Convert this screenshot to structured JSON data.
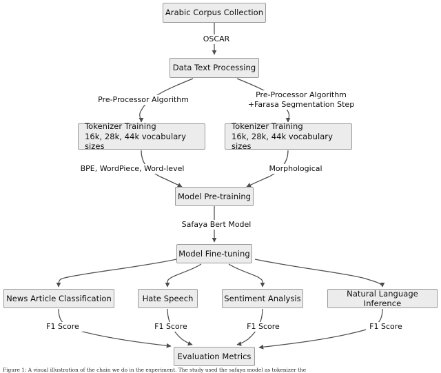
{
  "diagram": {
    "type": "flowchart",
    "title": "Arabic BERT pipeline flowchart",
    "colors": {
      "node_fill": "#ececec",
      "node_border": "#999999",
      "edge_stroke": "#4d4d4d",
      "text": "#0d0d0d",
      "background": "#ffffff"
    },
    "nodes": [
      {
        "id": "corpus",
        "label": "Arabic Corpus Collection"
      },
      {
        "id": "datatext",
        "label": "Data Text Processing"
      },
      {
        "id": "tokleft",
        "label": "Tokenizer Training\n16k, 28k, 44k vocabulary sizes"
      },
      {
        "id": "tokright",
        "label": "Tokenizer Training\n16k, 28k, 44k vocabulary sizes"
      },
      {
        "id": "pretrain",
        "label": "Model Pre-training"
      },
      {
        "id": "finetune",
        "label": "Model Fine-tuning"
      },
      {
        "id": "news",
        "label": "News Article Classification"
      },
      {
        "id": "hate",
        "label": "Hate Speech"
      },
      {
        "id": "sentiment",
        "label": "Sentiment Analysis"
      },
      {
        "id": "nli",
        "label": "Natural Language Inference"
      },
      {
        "id": "evaluation",
        "label": "Evaluation Metrics"
      }
    ],
    "edges": [
      {
        "from": "corpus",
        "to": "datatext",
        "label": "OSCAR"
      },
      {
        "from": "datatext",
        "to": "tokleft",
        "label": "Pre-Processor Algorithm"
      },
      {
        "from": "datatext",
        "to": "tokright",
        "label": "Pre-Processor Algorithm\n+Farasa Segmentation Step"
      },
      {
        "from": "tokleft",
        "to": "pretrain",
        "label": "BPE, WordPiece, Word-level"
      },
      {
        "from": "tokright",
        "to": "pretrain",
        "label": "Morphological"
      },
      {
        "from": "pretrain",
        "to": "finetune",
        "label": "Safaya Bert Model"
      },
      {
        "from": "finetune",
        "to": "news",
        "label": ""
      },
      {
        "from": "finetune",
        "to": "hate",
        "label": ""
      },
      {
        "from": "finetune",
        "to": "sentiment",
        "label": ""
      },
      {
        "from": "finetune",
        "to": "nli",
        "label": ""
      },
      {
        "from": "news",
        "to": "evaluation",
        "label": "F1 Score"
      },
      {
        "from": "hate",
        "to": "evaluation",
        "label": "F1 Score"
      },
      {
        "from": "sentiment",
        "to": "evaluation",
        "label": "F1 Score"
      },
      {
        "from": "nli",
        "to": "evaluation",
        "label": "F1 Score"
      }
    ]
  },
  "caption": {
    "text": "Figure 1: A visual illustration of the chain we do in the experiment. The study used the safaya model as tokenizer the"
  }
}
